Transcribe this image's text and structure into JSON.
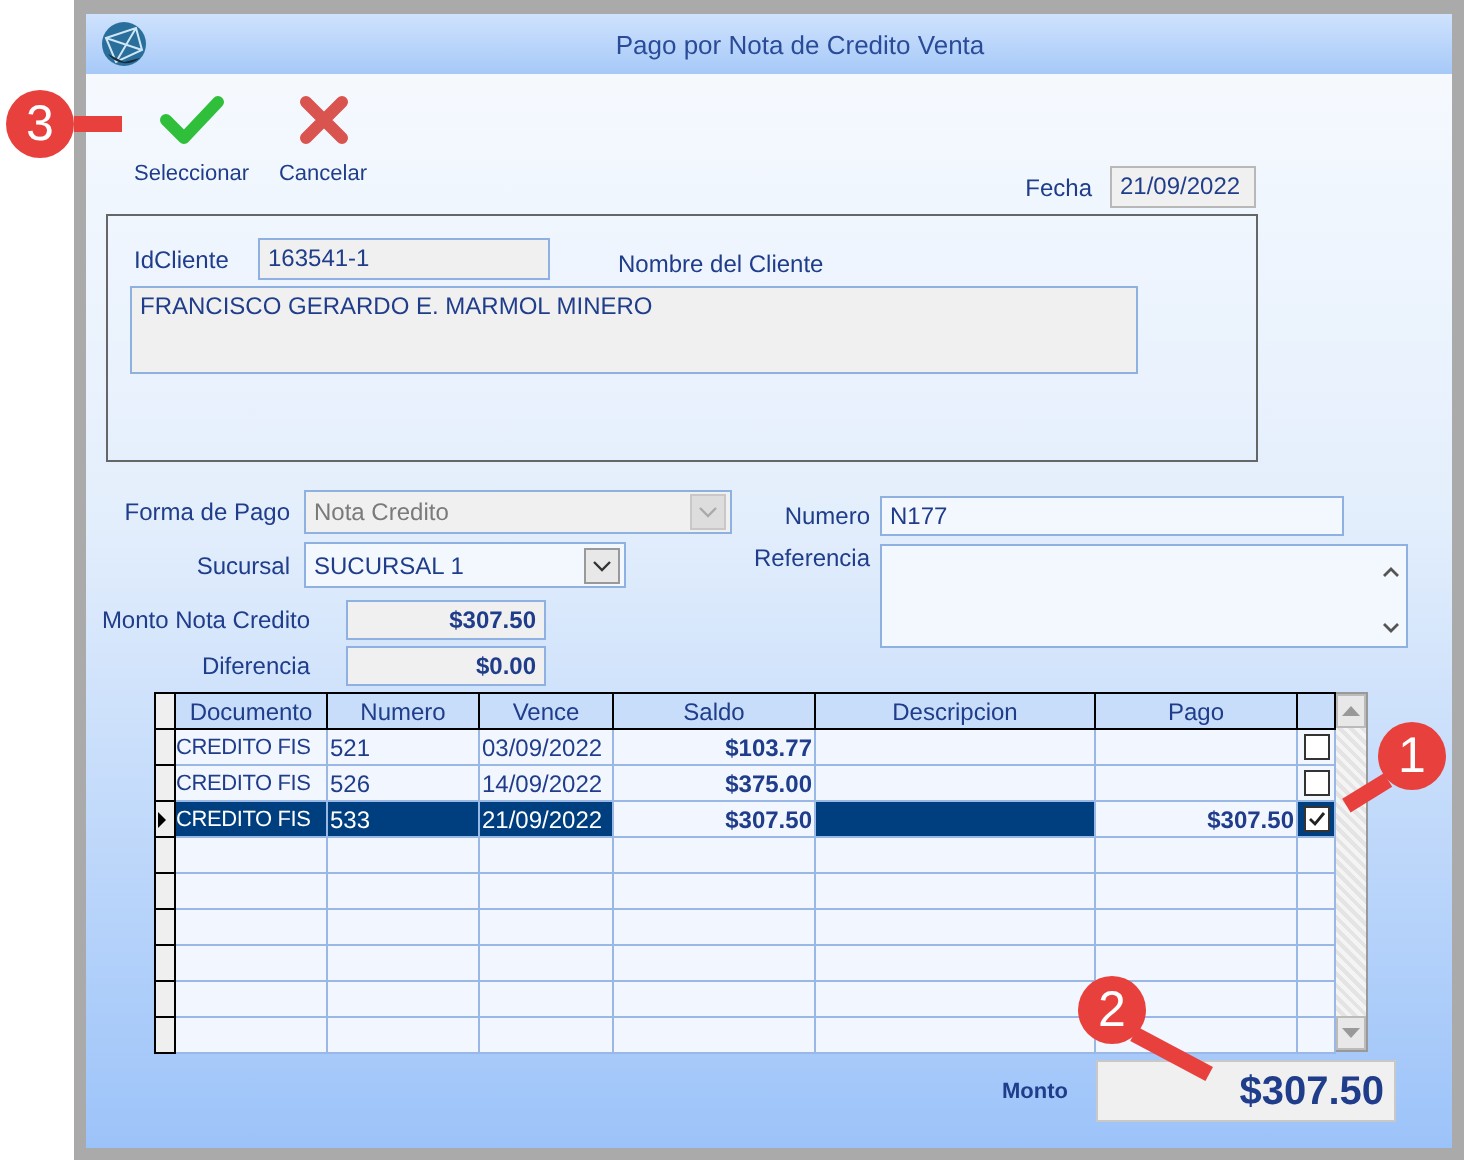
{
  "window": {
    "title": "Pago por Nota de Credito Venta"
  },
  "toolbar": [
    {
      "kind": "accept",
      "label": "Seleccionar"
    },
    {
      "kind": "cancel",
      "label": "Cancelar"
    }
  ],
  "fecha": {
    "label": "Fecha",
    "value": "21/09/2022"
  },
  "cliente": {
    "id_label": "IdCliente",
    "id_value": "163541-1",
    "name_label": "Nombre del Cliente",
    "name_value": "FRANCISCO GERARDO E. MARMOL MINERO"
  },
  "forma_de_pago": {
    "label": "Forma de Pago",
    "value": "Nota Credito",
    "disabled": true
  },
  "sucursal": {
    "label": "Sucursal",
    "value": "SUCURSAL 1",
    "disabled": false
  },
  "numero": {
    "label": "Numero",
    "value": "N177"
  },
  "referencia": {
    "label": "Referencia"
  },
  "monto_nota_credito": {
    "label": "Monto Nota Credito",
    "value": "$307.50"
  },
  "diferencia": {
    "label": "Diferencia",
    "value": "$0.00"
  },
  "table": {
    "columns": [
      {
        "label": "Documento",
        "kind": "text"
      },
      {
        "label": "Numero",
        "kind": "text"
      },
      {
        "label": "Vence",
        "kind": "text"
      },
      {
        "label": "Saldo",
        "kind": "money"
      },
      {
        "label": "Descripcion",
        "kind": "text"
      },
      {
        "label": "Pago",
        "kind": "money"
      }
    ],
    "rows": [
      {
        "cells": [
          "CREDITO FIS",
          "521",
          "03/09/2022",
          "$103.77",
          "",
          ""
        ],
        "checked": false,
        "selected": false,
        "current": false
      },
      {
        "cells": [
          "CREDITO FIS",
          "526",
          "14/09/2022",
          "$375.00",
          "",
          ""
        ],
        "checked": false,
        "selected": false,
        "current": false
      },
      {
        "cells": [
          "CREDITO FIS",
          "533",
          "21/09/2022",
          "$307.50",
          "",
          "$307.50"
        ],
        "checked": true,
        "selected": true,
        "current": true
      }
    ]
  },
  "monto": {
    "label": "Monto",
    "value": "$307.50"
  },
  "callouts": [
    {
      "label": "3"
    },
    {
      "label": "1"
    },
    {
      "label": "2"
    }
  ]
}
